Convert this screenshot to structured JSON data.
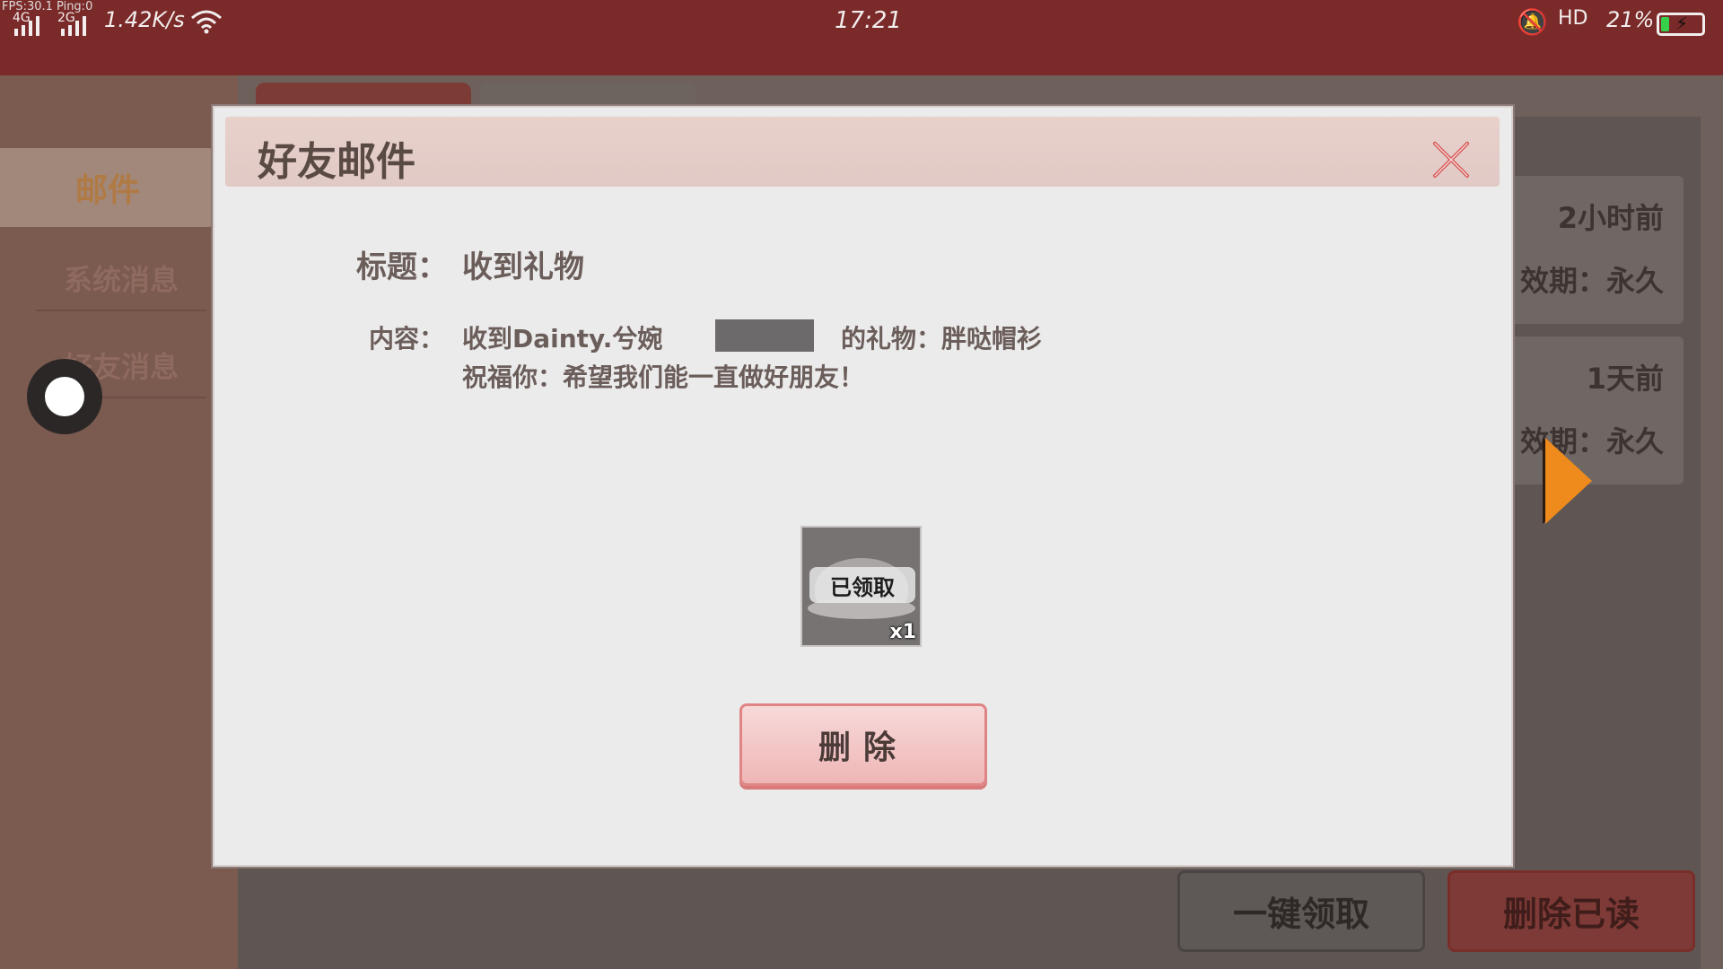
{
  "status_bar": {
    "fps": "FPS:30.1 Ping:0",
    "net_primary": "4G",
    "net_secondary": "2G",
    "speed": "1.42K/s",
    "time": "17:21",
    "hd": "HD",
    "battery_pct": "21%",
    "battery_level": 0.21
  },
  "background": {
    "left_tab_label": "邮件",
    "left_items": [
      "系统消息",
      "好友消息"
    ],
    "mail_cards": [
      {
        "time": "2小时前",
        "validity": "效期：永久"
      },
      {
        "time": "1天前",
        "validity": "效期：永久"
      }
    ],
    "claim_all_label": "一键领取",
    "delete_read_label": "删除已读"
  },
  "modal": {
    "title": "好友邮件",
    "title_label": "标题：",
    "title_value": "收到礼物",
    "content_label": "内容：",
    "content_line1_prefix": "收到Dainty.兮婉",
    "content_line1_suffix": "的礼物：胖哒帽衫",
    "content_line2": "祝福你：希望我们能一直做好朋友！",
    "item": {
      "status": "已领取",
      "quantity": "x1",
      "icon": "hat-icon"
    },
    "delete_label": "删除"
  },
  "colors": {
    "header_bg": "#e1cac5",
    "modal_bg": "#ebebeb",
    "delete_btn": "#efb6b6",
    "accent_arrow": "#ef8a1c",
    "close_x": "#d44a4a"
  }
}
